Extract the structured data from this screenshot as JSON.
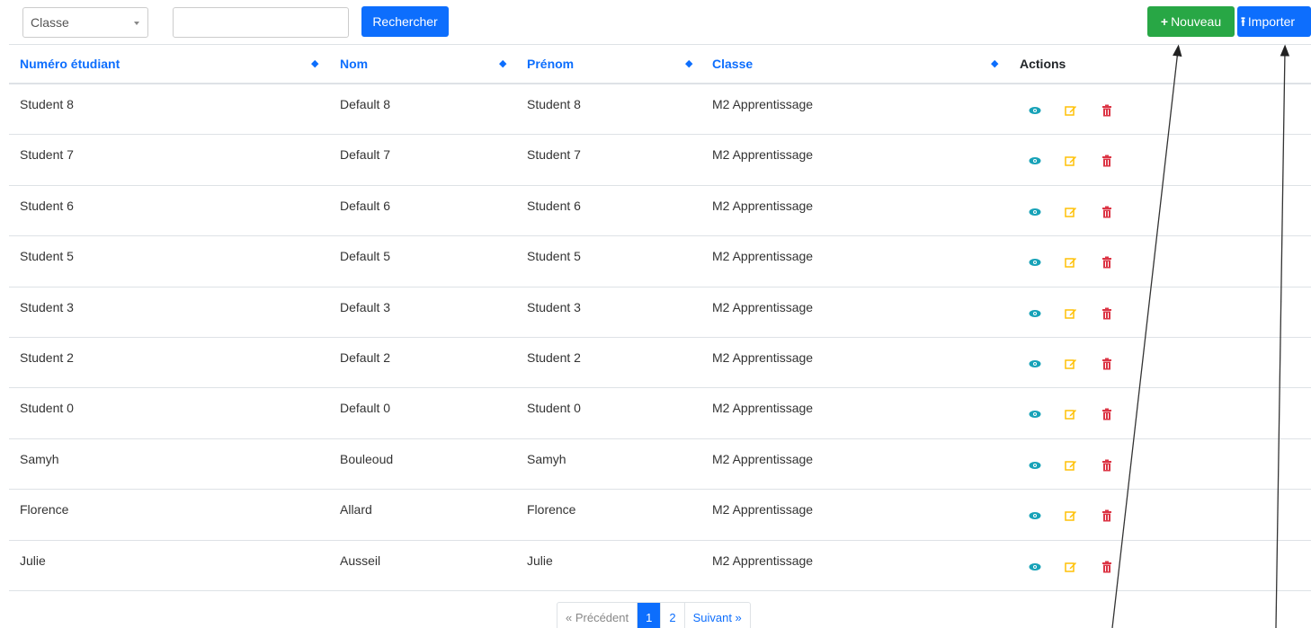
{
  "toolbar": {
    "class_select_value": "Classe",
    "search_value": "",
    "search_button": "Rechercher",
    "new_button": "Nouveau",
    "import_button": "Importer"
  },
  "table": {
    "columns": [
      "Numéro étudiant",
      "Nom",
      "Prénom",
      "Classe",
      "Actions"
    ],
    "rows": [
      {
        "numero": "Student 8",
        "nom": "Default 8",
        "prenom": "Student 8",
        "classe": "M2 Apprentissage"
      },
      {
        "numero": "Student 7",
        "nom": "Default 7",
        "prenom": "Student 7",
        "classe": "M2 Apprentissage"
      },
      {
        "numero": "Student 6",
        "nom": "Default 6",
        "prenom": "Student 6",
        "classe": "M2 Apprentissage"
      },
      {
        "numero": "Student 5",
        "nom": "Default 5",
        "prenom": "Student 5",
        "classe": "M2 Apprentissage"
      },
      {
        "numero": "Student 3",
        "nom": "Default 3",
        "prenom": "Student 3",
        "classe": "M2 Apprentissage"
      },
      {
        "numero": "Student 2",
        "nom": "Default 2",
        "prenom": "Student 2",
        "classe": "M2 Apprentissage"
      },
      {
        "numero": "Student 0",
        "nom": "Default 0",
        "prenom": "Student 0",
        "classe": "M2 Apprentissage"
      },
      {
        "numero": "Samyh",
        "nom": "Bouleoud",
        "prenom": "Samyh",
        "classe": "M2 Apprentissage"
      },
      {
        "numero": "Florence",
        "nom": "Allard",
        "prenom": "Florence",
        "classe": "M2 Apprentissage"
      },
      {
        "numero": "Julie",
        "nom": "Ausseil",
        "prenom": "Julie",
        "classe": "M2 Apprentissage"
      }
    ],
    "row_actions": [
      "eye-icon",
      "edit-icon",
      "trash-icon"
    ]
  },
  "pagination": {
    "prev": "« Précédent",
    "pages": [
      "1",
      "2"
    ],
    "active_page": "1",
    "next": "Suivant »"
  },
  "colors": {
    "primary": "#0d6efd",
    "success": "#28a745",
    "view": "#17a2b8",
    "edit": "#ffc107",
    "delete": "#dc3545"
  }
}
